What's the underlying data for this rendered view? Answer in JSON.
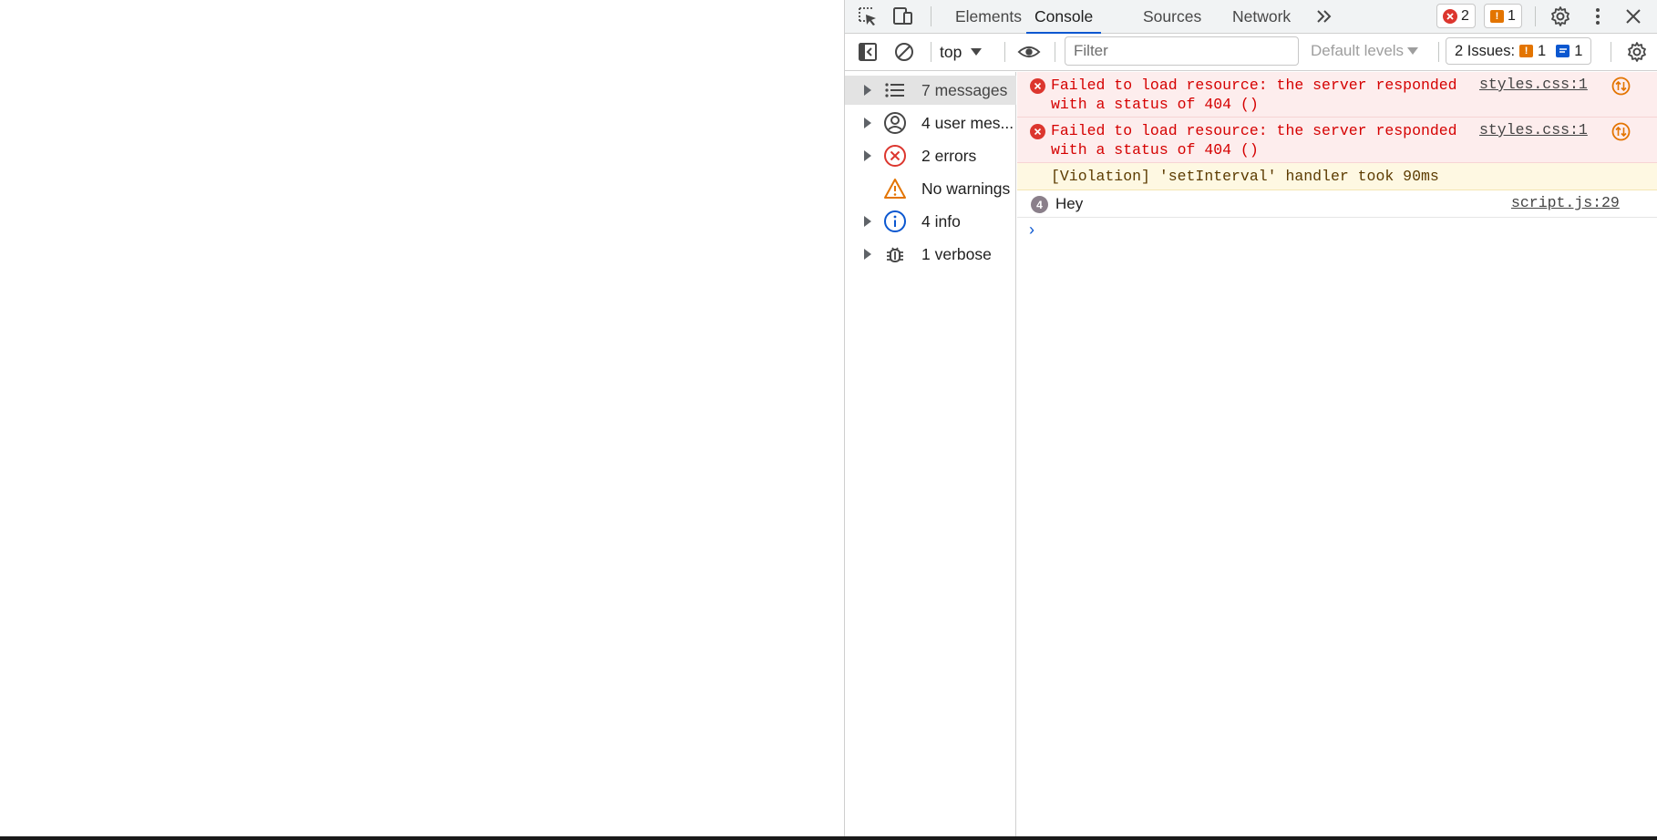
{
  "colors": {
    "accent": "#0b57d0",
    "error_text": "#d50000",
    "error_bg": "#fdeded",
    "warning_bg": "#fef8e2",
    "warning_icon": "#e37400",
    "toolbar_bg": "#f1f3f4"
  },
  "toolbar": {
    "icons": [
      "inspect-element-icon",
      "device-toggle-icon",
      "more-tabs-icon",
      "gear-icon",
      "kebab-menu-icon",
      "close-icon"
    ],
    "tabs": [
      {
        "label": "Elements",
        "active": false
      },
      {
        "label": "Console",
        "active": true
      },
      {
        "label": "Sources",
        "active": false
      },
      {
        "label": "Network",
        "active": false
      }
    ],
    "error_count": "2",
    "warning_count": "1"
  },
  "console_toolbar": {
    "context": "top",
    "filter_placeholder": "Filter",
    "levels": "Default levels",
    "issues_label": "2 Issues:",
    "issues_warning_count": "1",
    "issues_info_count": "1"
  },
  "sidebar": {
    "items": [
      {
        "label": "7 messages",
        "icon": "list-icon",
        "expandable": true,
        "selected": true
      },
      {
        "label": "4 user mes...",
        "icon": "user-icon",
        "expandable": true,
        "selected": false
      },
      {
        "label": "2 errors",
        "icon": "error-icon",
        "expandable": true,
        "selected": false
      },
      {
        "label": "No warnings",
        "icon": "warning-icon",
        "expandable": false,
        "selected": false
      },
      {
        "label": "4 info",
        "icon": "info-icon",
        "expandable": true,
        "selected": false
      },
      {
        "label": "1 verbose",
        "icon": "bug-icon",
        "expandable": true,
        "selected": false
      }
    ]
  },
  "messages": [
    {
      "level": "error",
      "line1": "Failed to load resource: the server responded",
      "line2": "with a status of 404 ()",
      "source": "styles.css:1"
    },
    {
      "level": "error",
      "line1": "Failed to load resource: the server responded",
      "line2": "with a status of 404 ()",
      "source": "styles.css:1"
    },
    {
      "level": "violation",
      "text": "[Violation] 'setInterval' handler took 90ms"
    },
    {
      "level": "log",
      "text": "Hey",
      "repeat": "4",
      "source": "script.js:29"
    }
  ],
  "prompt_symbol": "›"
}
